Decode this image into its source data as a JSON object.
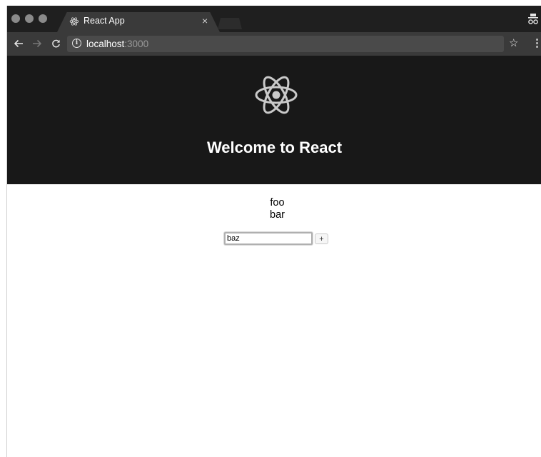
{
  "browser": {
    "tab_title": "React App",
    "tab_close": "×",
    "url_host": "localhost",
    "url_port": ":3000",
    "icons": {
      "back": "arrow-left-icon",
      "forward": "arrow-right-icon",
      "reload": "reload-icon",
      "info": "info-icon",
      "bookmark": "star-icon",
      "menu": "kebab-menu-icon",
      "incognito": "incognito-icon",
      "favicon": "react-logo-icon"
    }
  },
  "app": {
    "header_title": "Welcome to React",
    "header_bg": "#181818",
    "items": [
      "foo",
      "bar"
    ],
    "input_value": "baz",
    "add_button_label": "+"
  }
}
